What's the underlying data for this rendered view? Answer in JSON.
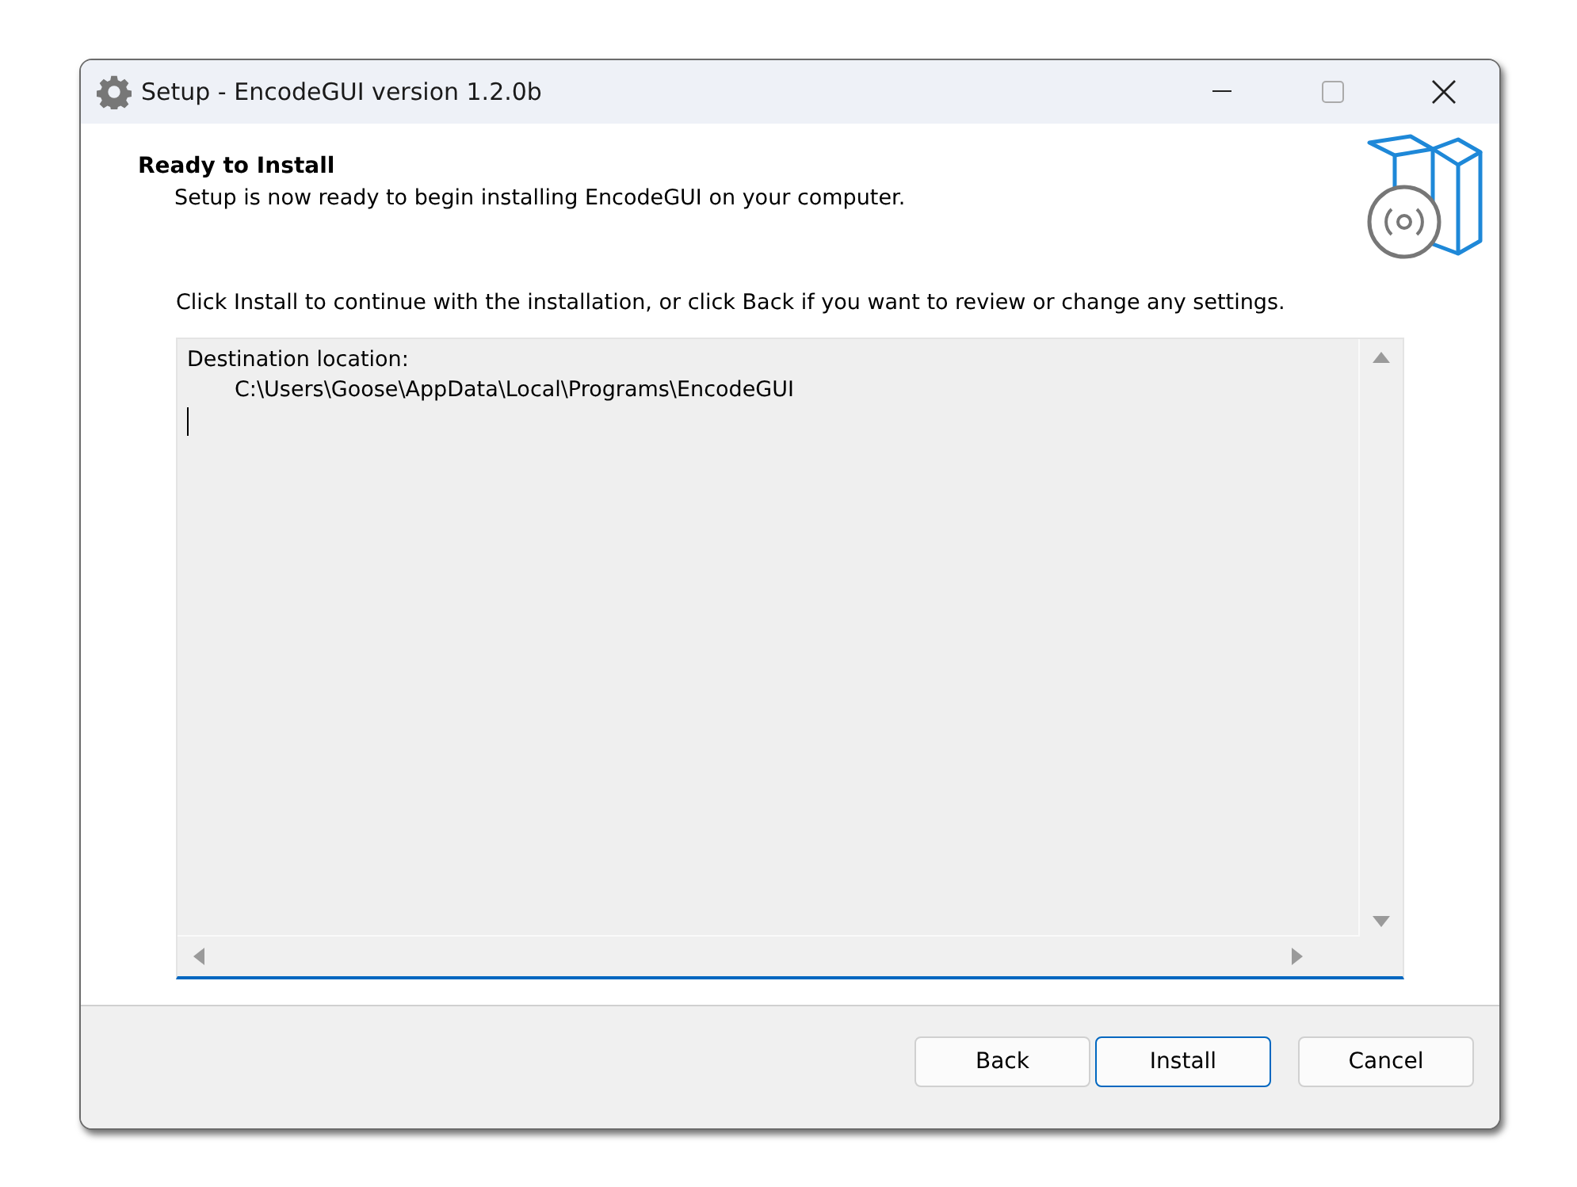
{
  "window": {
    "title": "Setup - EncodeGUI version 1.2.0b"
  },
  "header": {
    "title": "Ready to Install",
    "subtitle": "Setup is now ready to begin installing EncodeGUI on your computer."
  },
  "instructions": "Click Install to continue with the installation, or click Back if you want to review or change any settings.",
  "memo": {
    "lines": [
      {
        "text": "Destination location:",
        "indented": false
      },
      {
        "text": "C:\\Users\\Goose\\AppData\\Local\\Programs\\EncodeGUI",
        "indented": true
      }
    ]
  },
  "buttons": [
    {
      "label": "Back",
      "focused": false
    },
    {
      "label": "Install",
      "focused": true
    },
    {
      "label": "Cancel",
      "focused": false
    }
  ]
}
